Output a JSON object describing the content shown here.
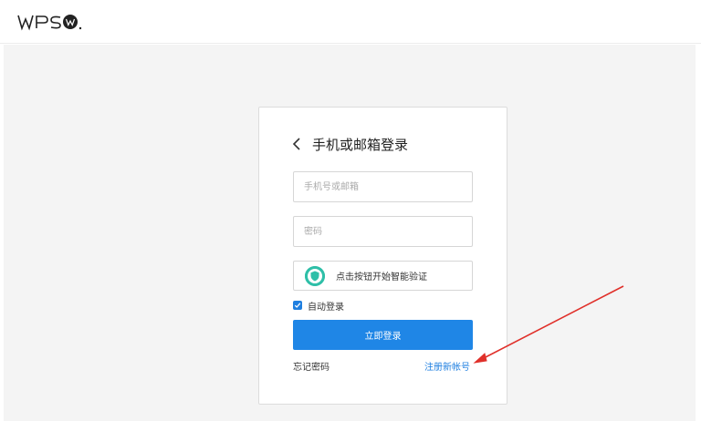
{
  "header": {
    "logo_text": "WPS",
    "logo_mark": "W"
  },
  "login": {
    "title": "手机或邮箱登录",
    "account_placeholder": "手机号或邮箱",
    "password_placeholder": "密码",
    "verify_label": "点击按钮开始智能验证",
    "auto_login_label": "自动登录",
    "auto_login_checked": true,
    "submit_label": "立即登录",
    "forgot_label": "忘记密码",
    "register_label": "注册新帐号"
  },
  "colors": {
    "primary": "#1f86e6",
    "link": "#1f7fe0",
    "verify_accent": "#2fbfa8",
    "annotation_arrow": "#e0302a"
  }
}
